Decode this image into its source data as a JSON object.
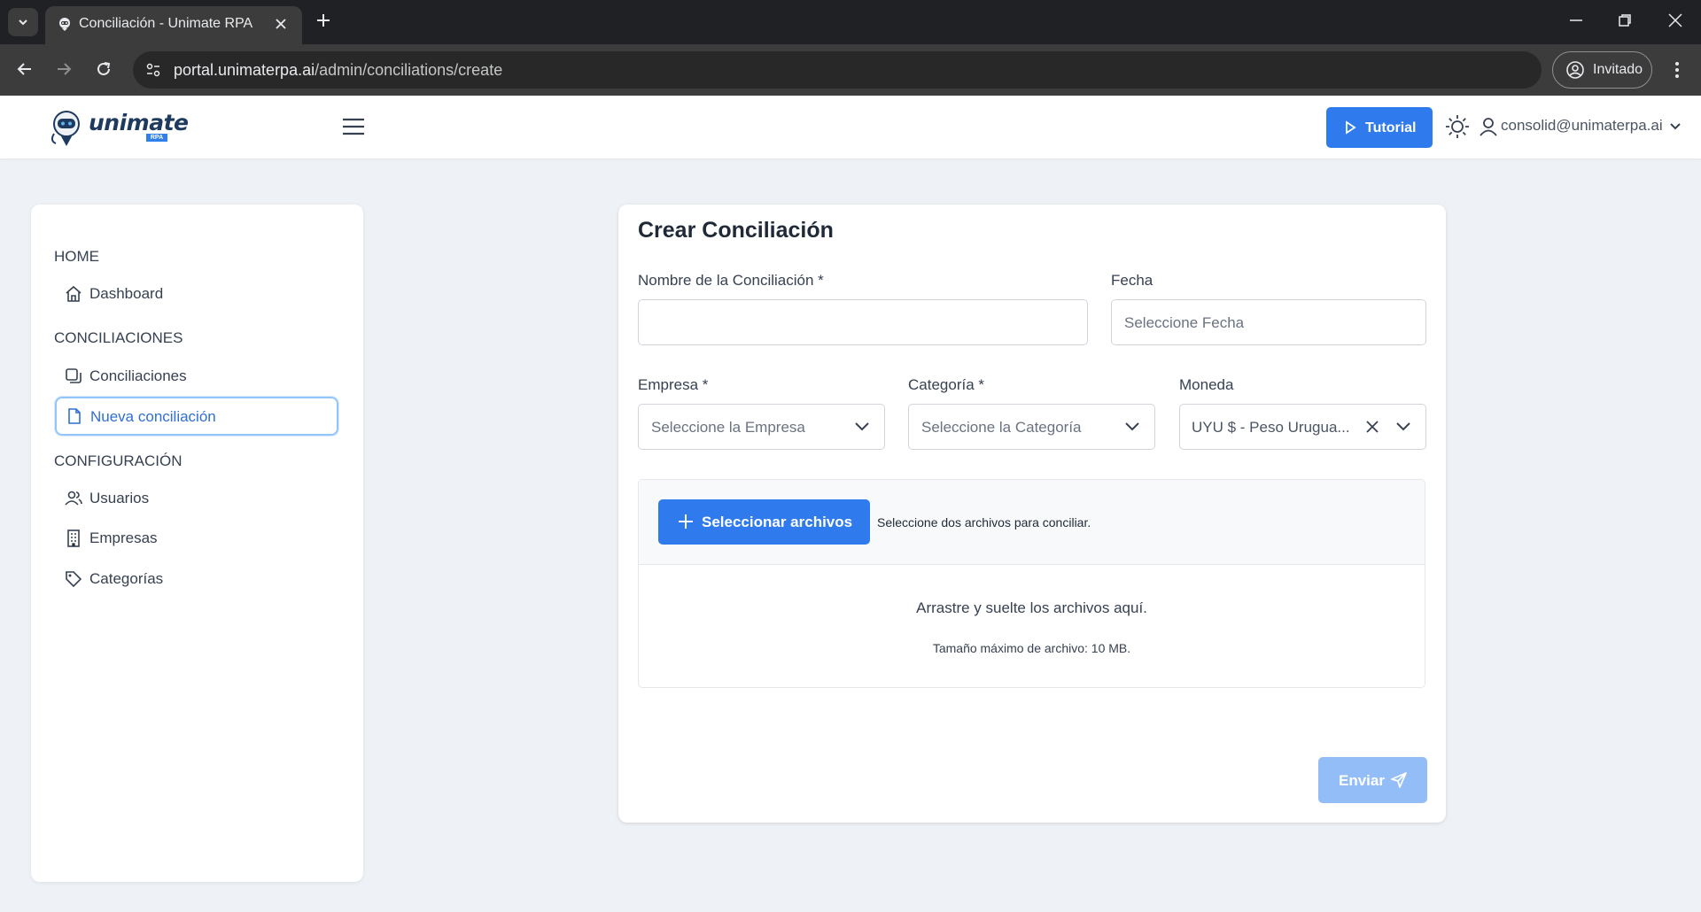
{
  "browser": {
    "tab_title": "Conciliación - Unimate RPA",
    "url_host": "portal.unimaterpa.ai",
    "url_path": "/admin/conciliations/create",
    "profile_label": "Invitado"
  },
  "header": {
    "logo_text": "unimate",
    "logo_sub": "RPA",
    "tutorial_label": "Tutorial",
    "user_email": "consolid@unimaterpa.ai"
  },
  "sidebar": {
    "sections": [
      {
        "title": "HOME",
        "items": [
          {
            "label": "Dashboard",
            "icon": "home-icon"
          }
        ]
      },
      {
        "title": "CONCILIACIONES",
        "items": [
          {
            "label": "Conciliaciones",
            "icon": "copy-icon"
          },
          {
            "label": "Nueva conciliación",
            "icon": "file-icon",
            "active": true
          }
        ]
      },
      {
        "title": "CONFIGURACIÓN",
        "items": [
          {
            "label": "Usuarios",
            "icon": "users-icon"
          },
          {
            "label": "Empresas",
            "icon": "building-icon"
          },
          {
            "label": "Categorías",
            "icon": "tag-icon"
          }
        ]
      }
    ]
  },
  "form": {
    "title": "Crear Conciliación",
    "name_label": "Nombre de la Conciliación *",
    "name_value": "",
    "date_label": "Fecha",
    "date_placeholder": "Seleccione Fecha",
    "company_label": "Empresa *",
    "company_placeholder": "Seleccione la Empresa",
    "category_label": "Categoría *",
    "category_placeholder": "Seleccione la Categoría",
    "currency_label": "Moneda",
    "currency_value": "UYU $ - Peso Urugua...",
    "select_files_label": "Seleccionar archivos",
    "select_files_hint": "Seleccione dos archivos para conciliar.",
    "drop_text": "Arrastre y suelte los archivos aquí.",
    "max_size_text": "Tamaño máximo de archivo: 10 MB.",
    "submit_label": "Enviar"
  },
  "colors": {
    "primary": "#2f7bed",
    "primary_disabled": "#93bdf6",
    "chrome_dark": "#202124",
    "page_bg": "#eef1f6"
  }
}
